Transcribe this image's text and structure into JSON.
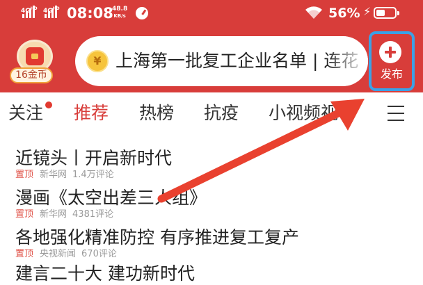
{
  "status_bar": {
    "sim1": "4G",
    "sim1_hd": "HD",
    "sim2": "4G",
    "sim2_hd": "HD",
    "time": "08:08",
    "speed_value": "48.8",
    "speed_unit": "KB/s",
    "battery_percent": "56%",
    "charging_icon": "lightning-bolt-icon"
  },
  "header": {
    "coins_label": "16金币",
    "search_text": "上海第一批复工企业名单 | 连花",
    "search_coin_glyph": "¥",
    "publish_label": "发布",
    "background_color": "#d83d3a",
    "highlight_color": "#3ca1e6"
  },
  "tabs": [
    {
      "label": "关注",
      "has_dot": true
    },
    {
      "label": "推荐",
      "active": true
    },
    {
      "label": "热榜"
    },
    {
      "label": "抗疫"
    },
    {
      "label": "小视频"
    },
    {
      "label": "视"
    }
  ],
  "news": [
    {
      "title": "近镜头丨开启新时代",
      "pin": "置顶",
      "source": "新华网",
      "comments": "1.4万评论"
    },
    {
      "title": "漫画《太空出差三人组》",
      "pin": "置顶",
      "source": "新华网",
      "comments": "4381评论"
    },
    {
      "title": "各地强化精准防控 有序推进复工复产",
      "pin": "置顶",
      "source": "央视新闻",
      "comments": "670评论"
    },
    {
      "title": "建言二十大 建功新时代"
    }
  ],
  "annotation": {
    "arrow_color": "#e9412f"
  }
}
